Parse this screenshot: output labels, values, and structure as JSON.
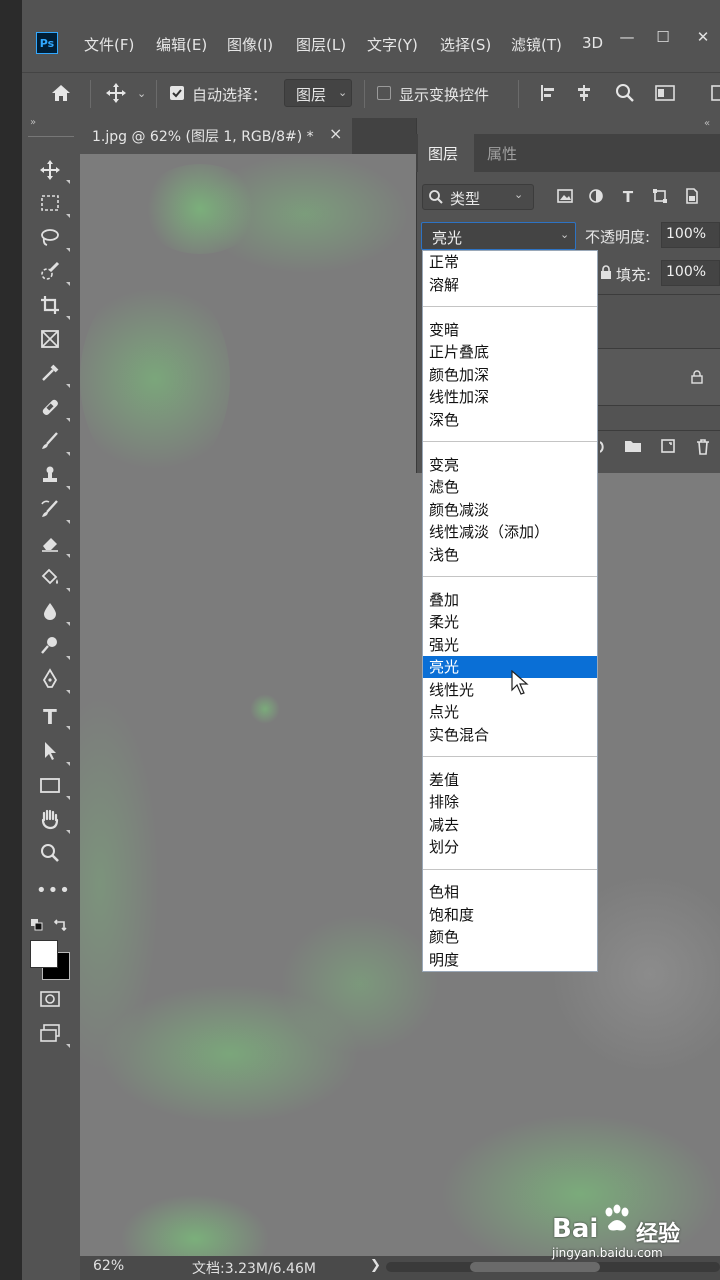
{
  "app": {
    "logo_text": "Ps"
  },
  "menubar": {
    "items": [
      "文件(F)",
      "编辑(E)",
      "图像(I)",
      "图层(L)",
      "文字(Y)",
      "选择(S)",
      "滤镜(T)",
      "3D"
    ],
    "window_buttons": [
      "—",
      "☐",
      "✕"
    ]
  },
  "optionsbar": {
    "auto_select_label": "自动选择：",
    "auto_select_checked": true,
    "auto_select_target": "图层",
    "show_transform_label": "显示变换控件",
    "show_transform_checked": false
  },
  "document": {
    "tab_title": "1.jpg @ 62% (图层 1, RGB/8#) *",
    "close_glyph": "×"
  },
  "layers_panel": {
    "tabs": [
      "图层",
      "属性"
    ],
    "filter_kind": "类型",
    "blend_mode": "亮光",
    "opacity_label": "不透明度:",
    "opacity_value": "100%",
    "fill_label": "填充:",
    "fill_value": "100%"
  },
  "blend_menu": {
    "groups": [
      [
        "正常",
        "溶解"
      ],
      [
        "变暗",
        "正片叠底",
        "颜色加深",
        "线性加深",
        "深色"
      ],
      [
        "变亮",
        "滤色",
        "颜色减淡",
        "线性减淡（添加）",
        "浅色"
      ],
      [
        "叠加",
        "柔光",
        "强光",
        "亮光",
        "线性光",
        "点光",
        "实色混合"
      ],
      [
        "差值",
        "排除",
        "减去",
        "划分"
      ],
      [
        "色相",
        "饱和度",
        "颜色",
        "明度"
      ]
    ],
    "selected": "亮光"
  },
  "statusbar": {
    "zoom": "62%",
    "doc_info": "文档:3.23M/6.46M",
    "arrow": "❯"
  },
  "watermark": {
    "brand_a": "Bai",
    "brand_b": "经验",
    "url": "jingyan.baidu.com"
  },
  "colors": {
    "accent": "#0a6fd6",
    "chrome": "#535353",
    "canvas": "#7c7c7c",
    "texture": "#7ad97a"
  }
}
